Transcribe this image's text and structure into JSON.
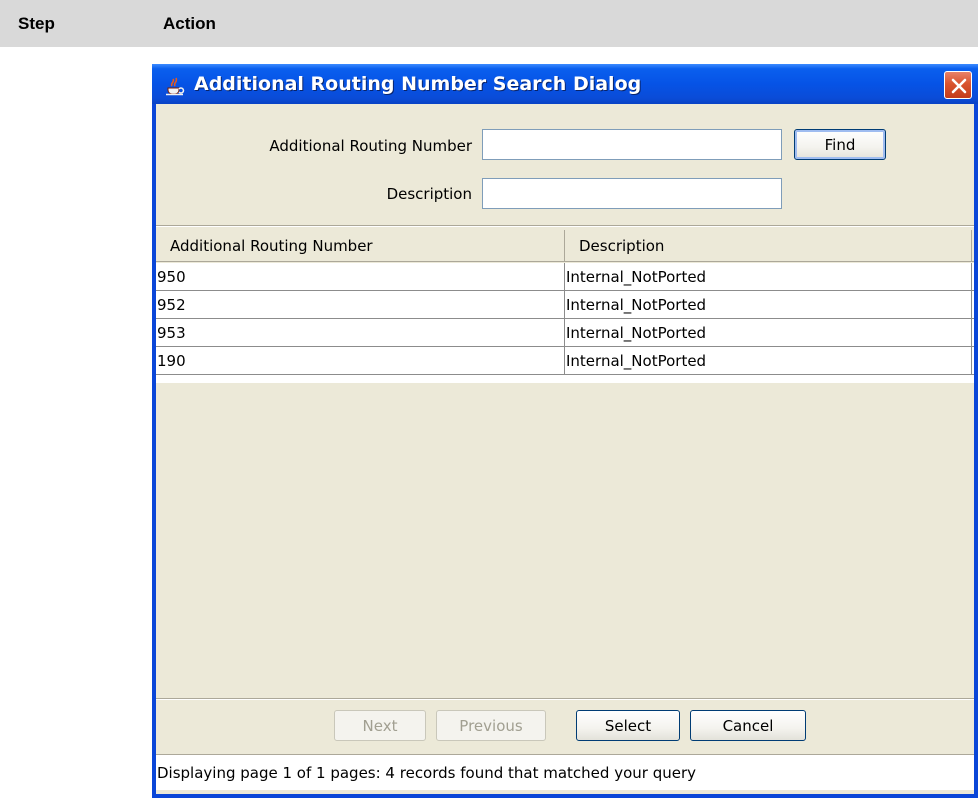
{
  "document": {
    "step_header": "Step",
    "action_header": "Action"
  },
  "window": {
    "title": "Additional Routing Number Search Dialog",
    "icon": "java-coffee-cup-icon",
    "close_icon": "close-icon"
  },
  "search_form": {
    "routing_number_label": "Additional Routing Number",
    "routing_number_value": "",
    "description_label": "Description",
    "description_value": "",
    "find_label": "Find"
  },
  "results_table": {
    "columns": [
      "Additional Routing Number",
      "Description"
    ],
    "rows": [
      {
        "number": "950",
        "description": "Internal_NotPorted"
      },
      {
        "number": "952",
        "description": "Internal_NotPorted"
      },
      {
        "number": "953",
        "description": "Internal_NotPorted"
      },
      {
        "number": "190",
        "description": "Internal_NotPorted"
      }
    ]
  },
  "buttons": {
    "next": "Next",
    "previous": "Previous",
    "select": "Select",
    "cancel": "Cancel"
  },
  "status": {
    "message": "Displaying page 1 of 1 pages:  4 records found that matched your query"
  }
}
